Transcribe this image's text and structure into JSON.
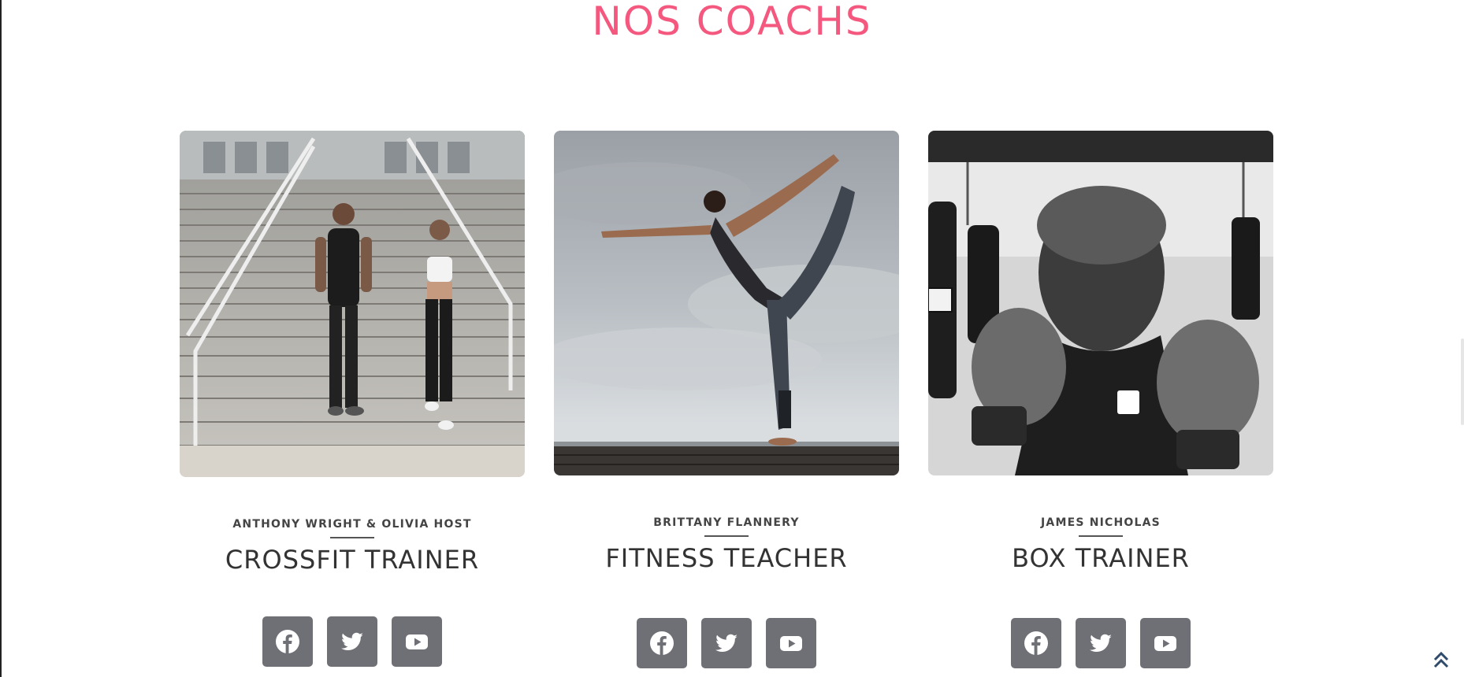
{
  "section": {
    "title": "NOS COACHS",
    "title_color": "#f5587e"
  },
  "coaches": [
    {
      "name": "ANTHONY WRIGHT & OLIVIA HOST",
      "role": "CROSSFIT TRAINER",
      "photo": "two-athletes-on-stadium-stairs"
    },
    {
      "name": "BRITTANY FLANNERY",
      "role": "FITNESS TEACHER",
      "photo": "woman-yoga-pose-cloudy-sky"
    },
    {
      "name": "JAMES NICHOLAS",
      "role": "BOX TRAINER",
      "photo": "boxer-with-gloves-black-and-white"
    }
  ],
  "social_icons": [
    "facebook-icon",
    "twitter-icon",
    "youtube-icon"
  ],
  "colors": {
    "button_bg": "#6f7076",
    "text": "#333333"
  }
}
